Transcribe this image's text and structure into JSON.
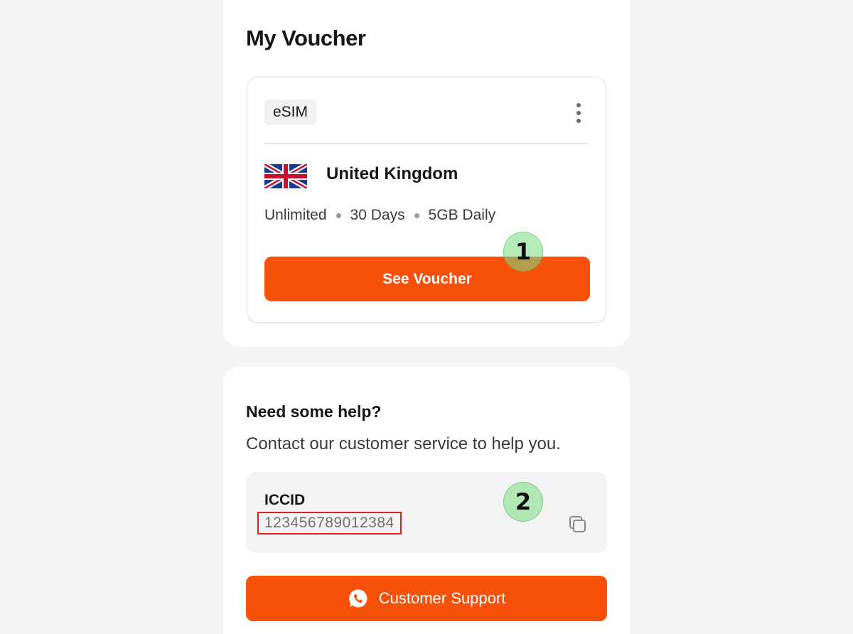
{
  "voucher_section": {
    "title": "My Voucher",
    "card": {
      "tag": "eSIM",
      "country": "United Kingdom",
      "flag_icon": "united-kingdom-flag",
      "plan": {
        "data_type": "Unlimited",
        "duration": "30 Days",
        "allowance": "5GB Daily"
      },
      "button_label": "See Voucher"
    }
  },
  "help_section": {
    "title": "Need some help?",
    "subtitle": "Contact our customer service to help you.",
    "iccid": {
      "label": "ICCID",
      "value": "123456789012384",
      "copy_icon": "copy-icon"
    },
    "support_button_label": "Customer Support",
    "support_icon": "whatsapp-icon"
  },
  "annotations": {
    "marker_1": "1",
    "marker_2": "2"
  },
  "colors": {
    "accent": "#F8520A",
    "background": "#F4F4F4",
    "card": "#FFFFFF",
    "highlight_border": "#E02020",
    "marker": "#78DC82"
  }
}
